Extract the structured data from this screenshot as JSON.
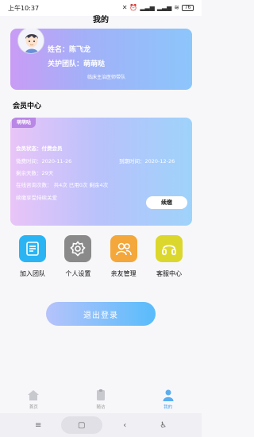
{
  "status": {
    "time": "上午10:37",
    "battery": "76"
  },
  "header": {
    "title": "我的"
  },
  "profile": {
    "name_label": "姓名：陈飞龙",
    "team_label": "关护团队：萌萌哒",
    "doctor_note": "临床主治医师带队"
  },
  "member_section": {
    "title": "会员中心"
  },
  "member_card": {
    "tag": "萌萌哒",
    "status_label": "会员状态：付费会员",
    "purchase_time": "微费时间：2020-11-26",
    "expire_time": "到期时间：2020-12-26",
    "remaining_days": "剩余天数：29天",
    "consult_line": "在线咨询次数：  共4次  已用0次  剩余4次",
    "renew_hint": "续缴享受持续关爱",
    "renew_button": "续缴"
  },
  "quick_actions": [
    {
      "label": "加入团队",
      "icon": "join-team-icon",
      "color": "#2bb4f4"
    },
    {
      "label": "个人设置",
      "icon": "gear-icon",
      "color": "#8a8a8a"
    },
    {
      "label": "亲友管理",
      "icon": "users-icon",
      "color": "#f4a73a"
    },
    {
      "label": "客服中心",
      "icon": "headset-icon",
      "color": "#dcd72c"
    }
  ],
  "logout": {
    "label": "退出登录"
  },
  "tabs": [
    {
      "label": "首页",
      "icon": "home-icon"
    },
    {
      "label": "随访",
      "icon": "followup-icon"
    },
    {
      "label": "我的",
      "icon": "user-icon"
    }
  ],
  "colors": {
    "accent": "#4aa3ee",
    "card_gradient_start": "#c99cf5",
    "card_gradient_end": "#8cc6fb"
  }
}
